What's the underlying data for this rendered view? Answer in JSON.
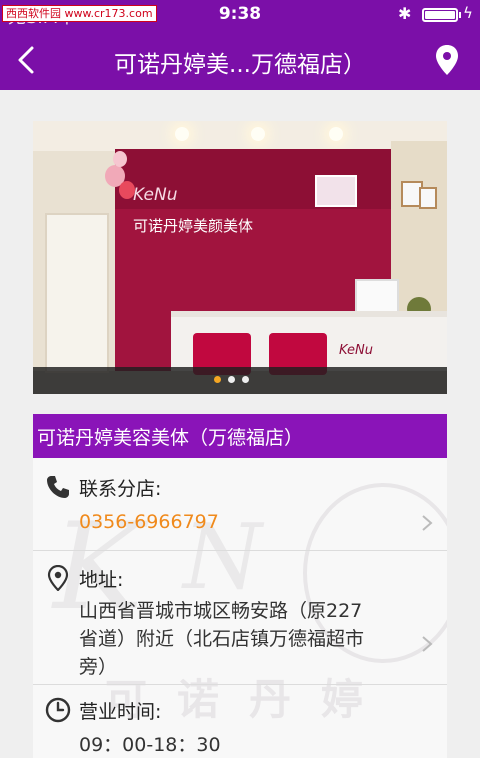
{
  "status_bar": {
    "watermark": "西西软件园 www.cr173.com",
    "carrier": "无SIM卡",
    "time": "9:38",
    "bluetooth": "bluetooth-icon",
    "battery_level": 1.0
  },
  "nav": {
    "title": "可诺丹婷美...万德福店）",
    "back_icon": "chevron-left-icon",
    "location_icon": "map-pin-icon"
  },
  "banner": {
    "logo_script": "KeNu",
    "sign_text": "可诺丹婷美颜美体",
    "counter_logo": "KeNu",
    "slide_count": 3,
    "active_slide": 1
  },
  "store": {
    "name": "可诺丹婷美容美体（万德福店）"
  },
  "contact": {
    "label": "联系分店:",
    "phone": "0356-6966797",
    "icon": "phone-icon"
  },
  "address": {
    "label": "地址:",
    "lines": [
      "山西省晋城市城区畅安路（原227",
      "省道）附近（北石店镇万德福超市",
      "旁）"
    ],
    "icon": "location-icon"
  },
  "hours": {
    "label": "营业时间:",
    "value": "09：00-18：30",
    "icon": "clock-icon"
  },
  "background_watermark": {
    "cn": "可诺丹婷"
  },
  "colors": {
    "brand_purple": "#7b0fa8",
    "store_bar": "#8a14b8",
    "phone_orange": "#f08a1c"
  }
}
